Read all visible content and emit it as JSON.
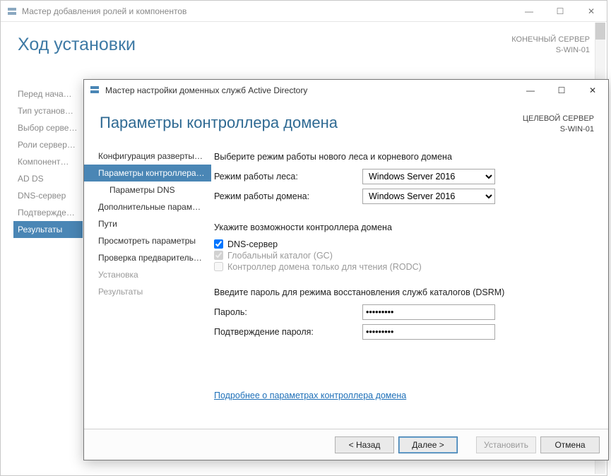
{
  "back": {
    "title": "Мастер добавления ролей и компонентов",
    "pageTitle": "Ход установки",
    "targetLabel": "КОНЕЧНЫЙ СЕРВЕР",
    "targetName": "S-WIN-01",
    "sidebar": [
      "Перед нача…",
      "Тип установ…",
      "Выбор серве…",
      "Роли сервер…",
      "Компонент…",
      "AD DS",
      "DNS-сервер",
      "Подтвержде…",
      "Результаты"
    ],
    "selectedIndex": 8
  },
  "front": {
    "title": "Мастер настройки доменных служб Active Directory",
    "pageTitle": "Параметры контроллера домена",
    "targetLabel": "ЦЕЛЕВОЙ СЕРВЕР",
    "targetName": "S-WIN-01",
    "sidebar": [
      {
        "label": "Конфигурация разверты…",
        "selected": false,
        "sub": false,
        "disabled": false
      },
      {
        "label": "Параметры контроллера…",
        "selected": true,
        "sub": false,
        "disabled": false
      },
      {
        "label": "Параметры DNS",
        "selected": false,
        "sub": true,
        "disabled": false
      },
      {
        "label": "Дополнительные парам…",
        "selected": false,
        "sub": false,
        "disabled": false
      },
      {
        "label": "Пути",
        "selected": false,
        "sub": false,
        "disabled": false
      },
      {
        "label": "Просмотреть параметры",
        "selected": false,
        "sub": false,
        "disabled": false
      },
      {
        "label": "Проверка предваритель…",
        "selected": false,
        "sub": false,
        "disabled": false
      },
      {
        "label": "Установка",
        "selected": false,
        "sub": false,
        "disabled": true
      },
      {
        "label": "Результаты",
        "selected": false,
        "sub": false,
        "disabled": true
      }
    ],
    "content": {
      "intro1": "Выберите режим работы нового леса и корневого домена",
      "forestLabel": "Режим работы леса:",
      "forestValue": "Windows Server 2016",
      "domainLabel": "Режим работы домена:",
      "domainValue": "Windows Server 2016",
      "capsLabel": "Укажите возможности контроллера домена",
      "chkDns": "DNS-сервер",
      "chkGc": "Глобальный каталог (GC)",
      "chkRodc": "Контроллер домена только для чтения (RODC)",
      "dsrmLabel": "Введите пароль для режима восстановления служб каталогов (DSRM)",
      "pwdLabel": "Пароль:",
      "pwdValue": "•••••••••",
      "pwd2Label": "Подтверждение пароля:",
      "pwd2Value": "•••••••••",
      "moreLink": "Подробнее о параметрах контроллера домена"
    },
    "buttons": {
      "back": "< Назад",
      "next": "Далее >",
      "install": "Установить",
      "cancel": "Отмена"
    }
  }
}
